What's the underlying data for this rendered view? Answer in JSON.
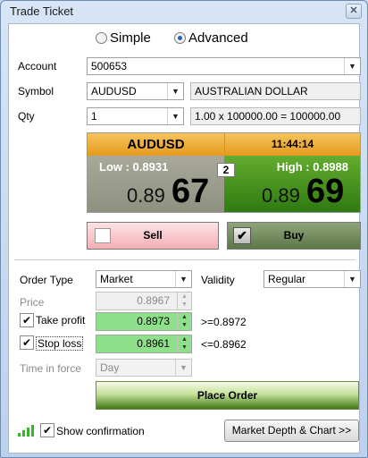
{
  "window": {
    "title": "Trade Ticket",
    "close_glyph": "✕"
  },
  "mode": {
    "options": [
      "Simple",
      "Advanced"
    ],
    "selected": "Advanced"
  },
  "account": {
    "label": "Account",
    "value": "500653"
  },
  "symbol": {
    "label": "Symbol",
    "value": "AUDUSD",
    "description": "AUSTRALIAN DOLLAR"
  },
  "qty": {
    "label": "Qty",
    "value": "1",
    "calc": "1.00 x 100000.00 = 100000.00"
  },
  "quote": {
    "instrument": "AUDUSD",
    "time": "11:44:14",
    "low": "Low : 0.8931",
    "high": "High : 0.8988",
    "bid_prefix": "0.89",
    "bid_pips": "67",
    "ask_prefix": "0.89",
    "ask_pips": "69",
    "spread": "2",
    "colors": {
      "header": "#f0b13c",
      "sell_bg": "#a3a594",
      "buy_bg": "#4f9f20"
    }
  },
  "trade_buttons": {
    "sell": "Sell",
    "buy": "Buy",
    "sell_color": "#f7c2c6",
    "buy_color": "#6f8758"
  },
  "order": {
    "order_type_label": "Order Type",
    "order_type_value": "Market",
    "validity_label": "Validity",
    "validity_value": "Regular",
    "price_label": "Price",
    "price_value": "0.8967",
    "take_profit_label": "Take profit",
    "take_profit_value": "0.8973",
    "take_profit_hint": ">=0.8972",
    "stop_loss_label": "Stop loss",
    "stop_loss_value": "0.8961",
    "stop_loss_hint": "<=0.8962",
    "time_in_force_label": "Time in force",
    "time_in_force_value": "Day",
    "place_order": "Place Order"
  },
  "footer": {
    "show_confirmation": "Show confirmation",
    "market_depth": "Market Depth & Chart >>",
    "signal_icon": "signal-strength-icon",
    "signal_color": "#35b52a"
  }
}
